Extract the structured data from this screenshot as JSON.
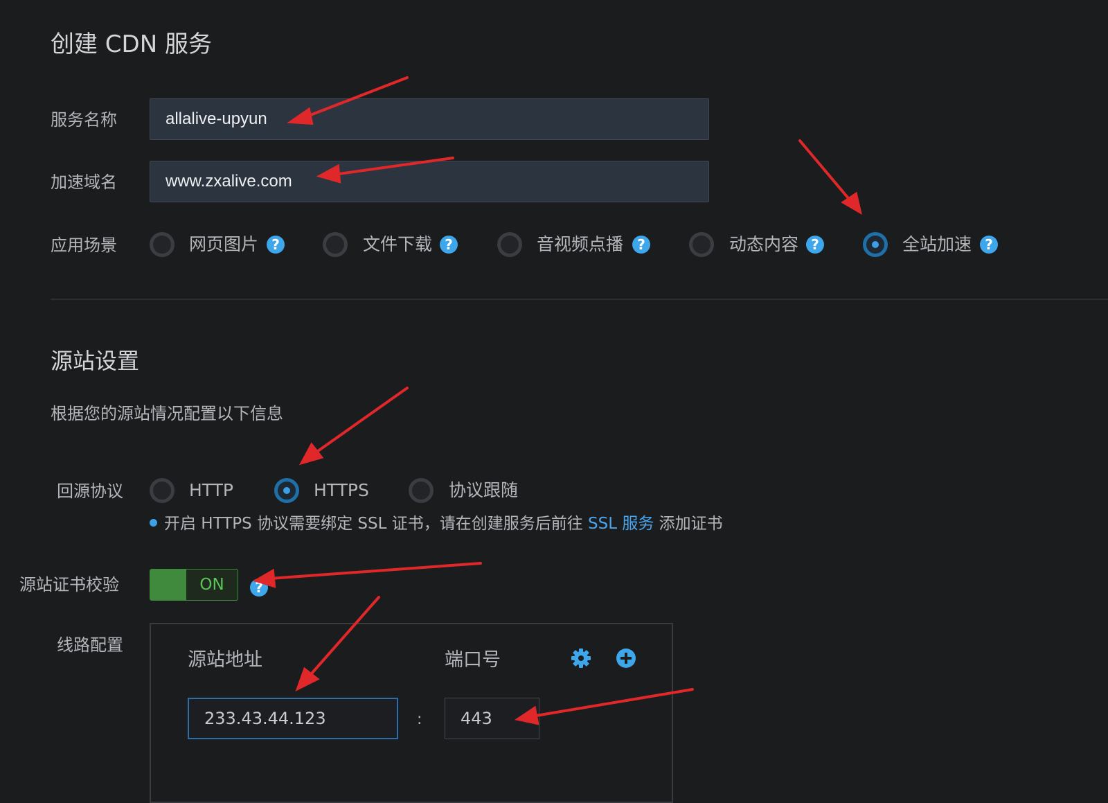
{
  "page_title": "创建 CDN 服务",
  "service": {
    "name_label": "服务名称",
    "name_value": "allalive-upyun",
    "domain_label": "加速域名",
    "domain_value": "www.zxalive.com",
    "scene_label": "应用场景",
    "scenes": [
      {
        "label": "网页图片",
        "selected": false
      },
      {
        "label": "文件下载",
        "selected": false
      },
      {
        "label": "音视频点播",
        "selected": false
      },
      {
        "label": "动态内容",
        "selected": false
      },
      {
        "label": "全站加速",
        "selected": true
      }
    ],
    "help_glyph": "?"
  },
  "origin": {
    "section_title": "源站设置",
    "section_desc": "根据您的源站情况配置以下信息",
    "protocol_label": "回源协议",
    "protocols": [
      {
        "label": "HTTP",
        "selected": false
      },
      {
        "label": "HTTPS",
        "selected": true
      },
      {
        "label": "协议跟随",
        "selected": false
      }
    ],
    "note_prefix": "开启 HTTPS 协议需要绑定 SSL 证书，请在创建服务后前往",
    "note_link": "SSL 服务",
    "note_suffix": "添加证书",
    "cert_check_label": "源站证书校验",
    "cert_check_state": "ON",
    "route_label": "线路配置",
    "address_header": "源站地址",
    "port_header": "端口号",
    "address_value": "233.43.44.123",
    "separator": ":",
    "port_value": "443"
  },
  "colors": {
    "background": "#1b1c1e",
    "accent_blue": "#3ea6ea",
    "toggle_green": "#3f8a3c",
    "annotation_red": "#e0282a"
  },
  "icons": {
    "settings": "gear-icon",
    "add": "plus-circle-icon",
    "help": "question-circle-icon"
  }
}
